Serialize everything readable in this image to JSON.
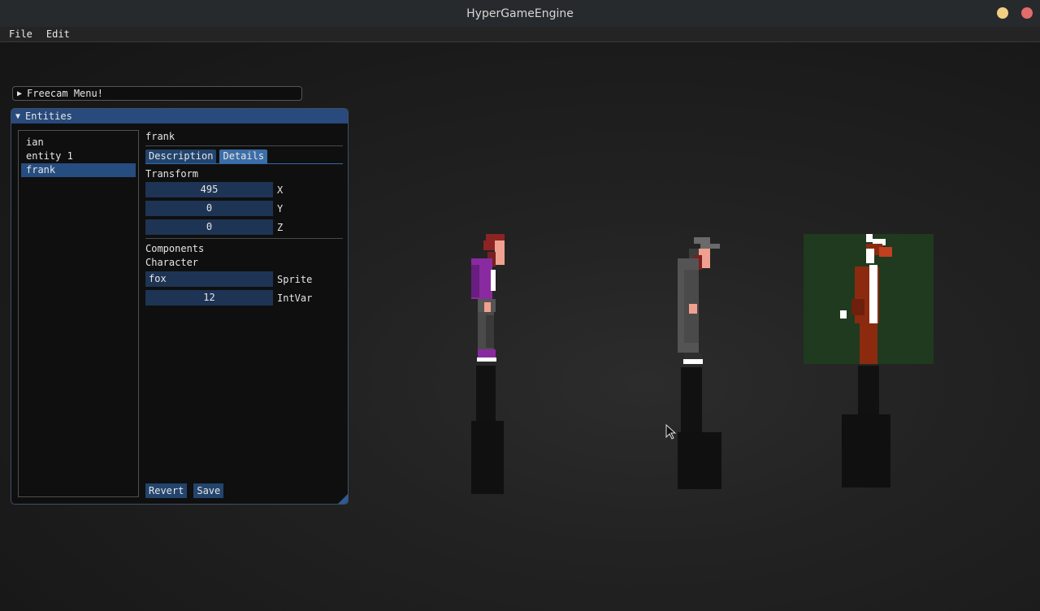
{
  "window": {
    "title": "HyperGameEngine"
  },
  "menubar": {
    "items": [
      "File",
      "Edit"
    ]
  },
  "freecam": {
    "label": "Freecam Menu!"
  },
  "entities": {
    "title": "Entities",
    "list": [
      {
        "label": "ian",
        "selected": false
      },
      {
        "label": "entity 1",
        "selected": false
      },
      {
        "label": "frank",
        "selected": true
      }
    ],
    "selected_name": "frank",
    "tabs": [
      {
        "label": "Description",
        "active": false
      },
      {
        "label": "Details",
        "active": true
      }
    ],
    "transform": {
      "title": "Transform",
      "x": {
        "value": "495",
        "label": "X"
      },
      "y": {
        "value": "0",
        "label": "Y"
      },
      "z": {
        "value": "0",
        "label": "Z"
      }
    },
    "components": {
      "title": "Components",
      "character": "Character",
      "sprite": {
        "value": "fox",
        "label": "Sprite"
      },
      "intvar": {
        "value": "12",
        "label": "IntVar"
      }
    },
    "buttons": {
      "revert": "Revert",
      "save": "Save"
    }
  },
  "colors": {
    "accent": "#284a7c",
    "field_bg": "#1e3454",
    "selection_bg": "#3c5a2a",
    "win_minimize": "#f0cf85",
    "win_close": "#e46b6b"
  }
}
